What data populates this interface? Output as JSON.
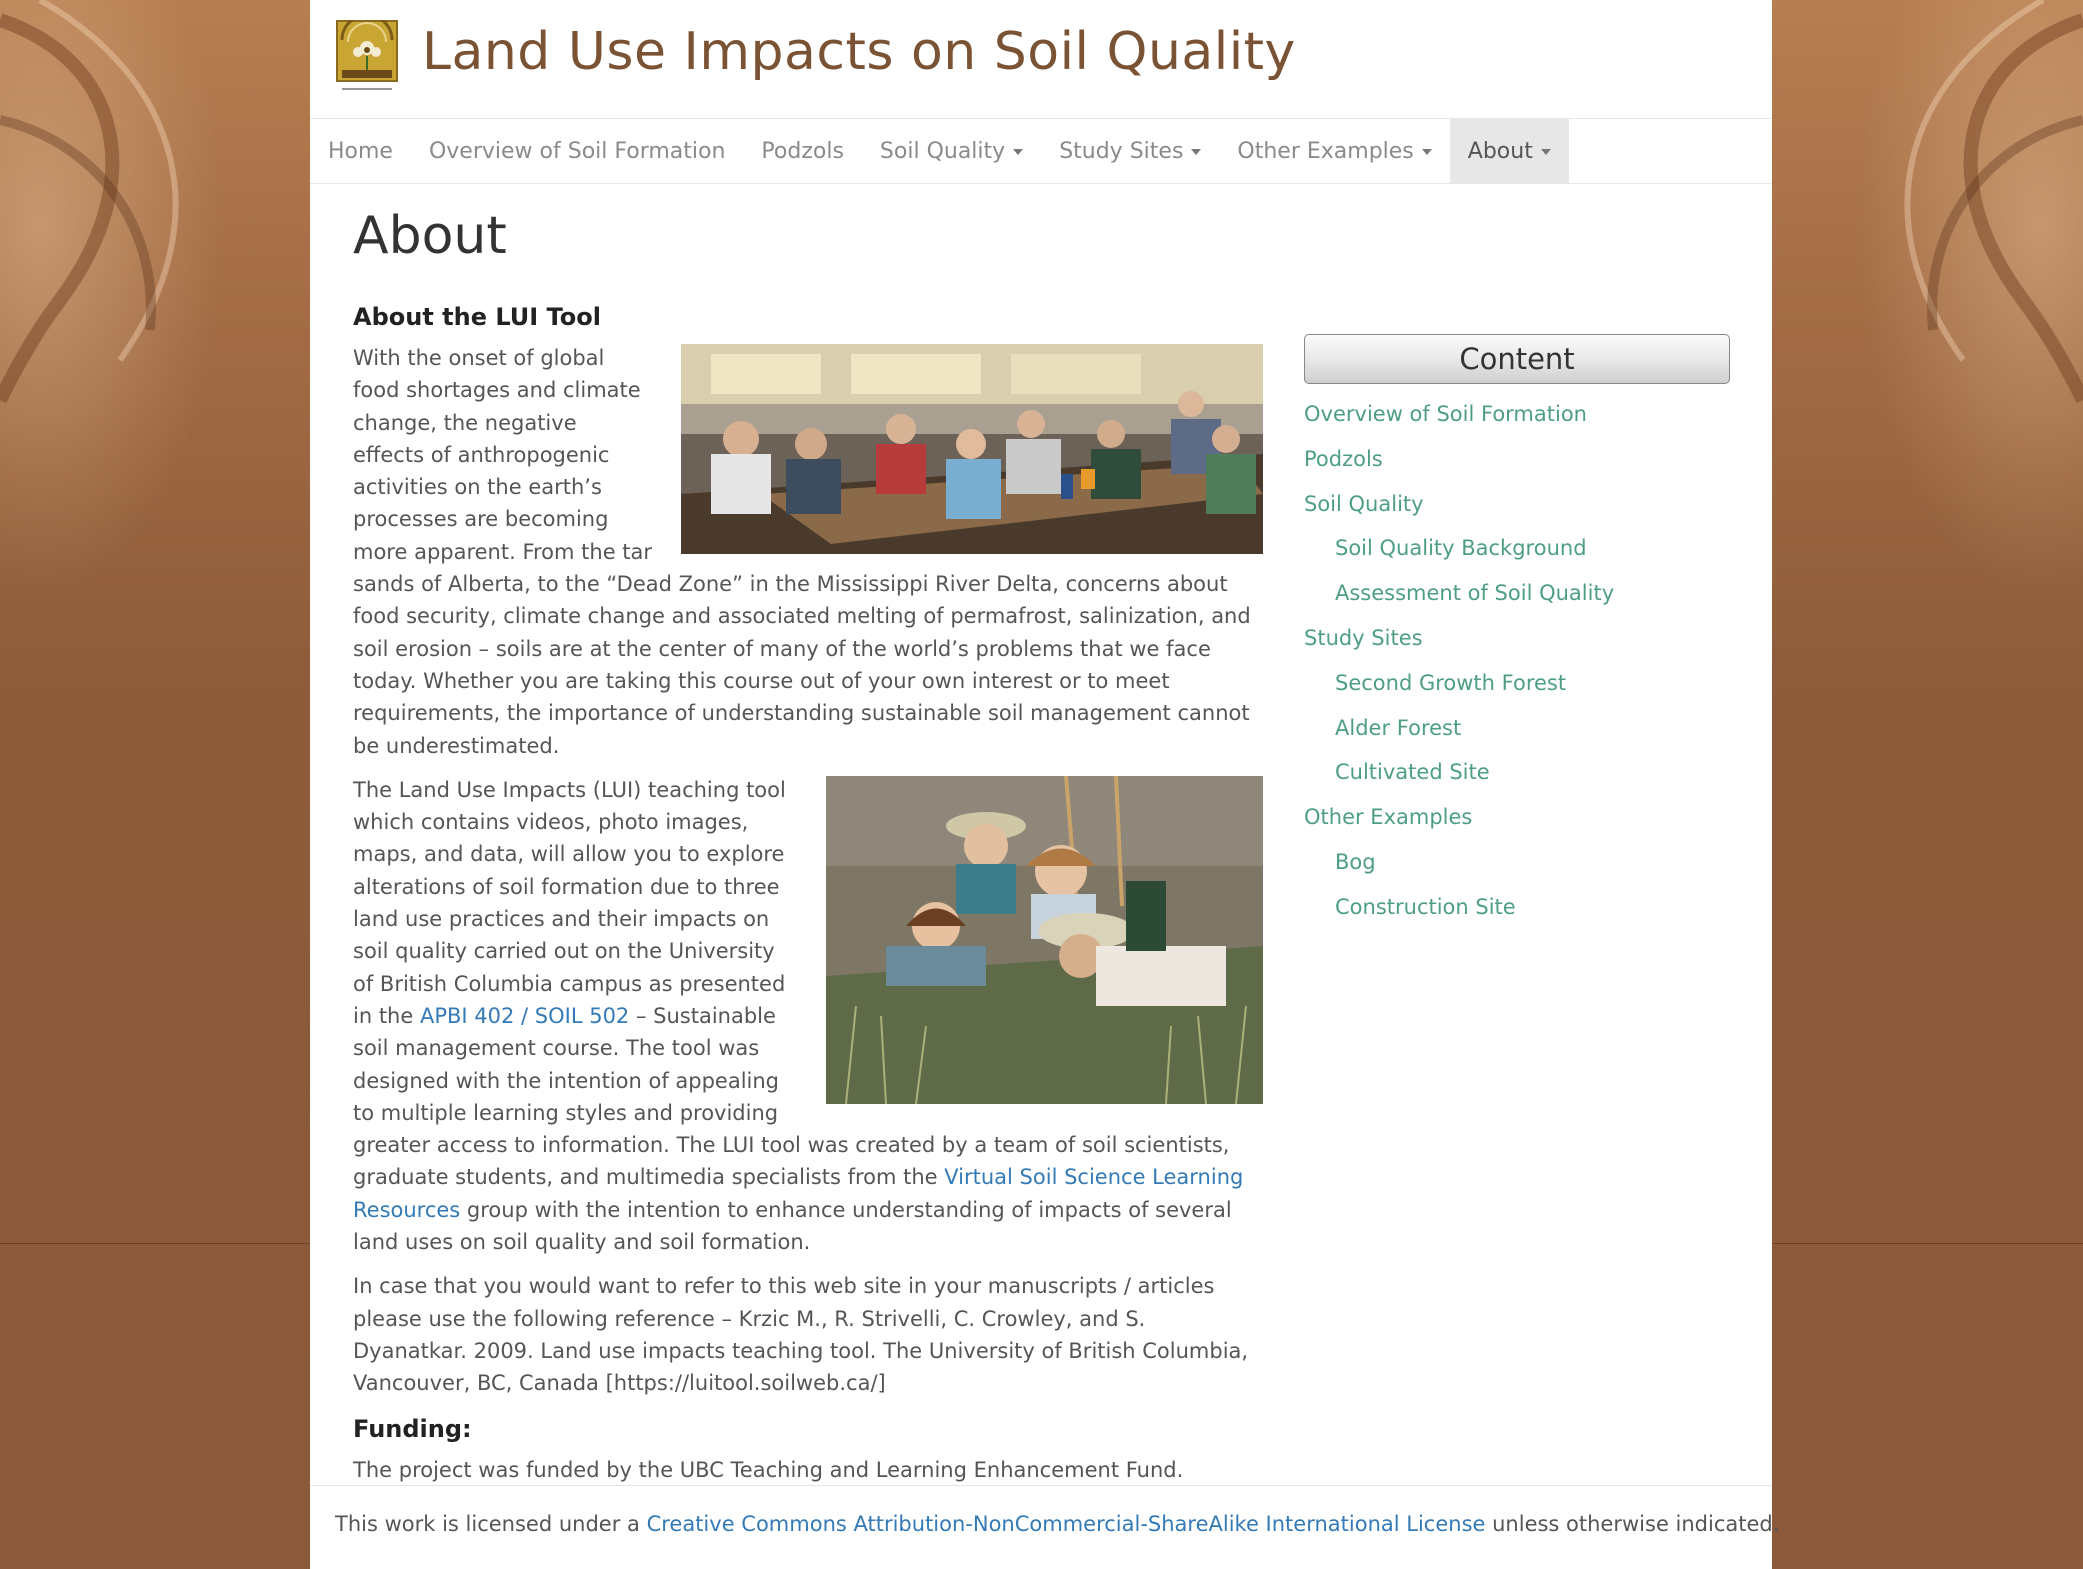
{
  "site": {
    "title": "Land Use Impacts on Soil Quality",
    "logo_icon": "luitool-logo-icon"
  },
  "nav": {
    "items": [
      {
        "label": "Home",
        "dropdown": false,
        "active": false
      },
      {
        "label": "Overview of Soil Formation",
        "dropdown": false,
        "active": false
      },
      {
        "label": "Podzols",
        "dropdown": false,
        "active": false
      },
      {
        "label": "Soil Quality",
        "dropdown": true,
        "active": false
      },
      {
        "label": "Study Sites",
        "dropdown": true,
        "active": false
      },
      {
        "label": "Other Examples",
        "dropdown": true,
        "active": false
      },
      {
        "label": "About",
        "dropdown": true,
        "active": true
      }
    ]
  },
  "page": {
    "title": "About"
  },
  "main": {
    "about_heading": "About the LUI Tool",
    "para1": "With the onset of global food shortages and climate change, the negative effects of anthropogenic activities on the earth’s processes are becoming more apparent. From the tar sands of Alberta, to the “Dead Zone” in the Mississippi River Delta, concerns about food security, climate change and associated melting of permafrost, salinization, and soil erosion – soils are at the center of many of the world’s problems that we face today. Whether you are taking this course out of your own interest or to meet requirements, the importance of understanding sustainable soil management cannot be underestimated.",
    "para2_part1": "The Land Use Impacts (LUI) teaching tool which contains videos, photo images, maps, and data, will allow you to explore alterations of soil formation due to three land use practices and their impacts on soil quality carried out on the University of British Columbia campus as presented in the ",
    "para2_link1": "APBI 402 / SOIL 502",
    "para2_part2": " – Sustainable soil management course. The tool was designed with the intention of appealing to multiple learning styles and providing greater access to information. The LUI tool was created by a team of soil scientists, graduate students, and multimedia specialists from the ",
    "para2_link2": "Virtual Soil Science Learning Resources",
    "para2_part3": " group with the intention to enhance understanding of impacts of several land uses on soil quality and soil formation.",
    "para3": "In case that you would want to refer to this web site in your manuscripts / articles please use the following reference – Krzic M., R. Strivelli, C. Crowley, and S. Dyanatkar. 2009. Land use impacts teaching tool. The University of British Columbia, Vancouver, BC, Canada [https://luitool.soilweb.ca/]",
    "funding_heading": "Funding:",
    "funding_text": "The project was funded by the UBC Teaching and Learning Enhancement Fund."
  },
  "sidebar": {
    "heading": "Content",
    "items": [
      {
        "label": "Overview of Soil Formation",
        "sub": false
      },
      {
        "label": "Podzols",
        "sub": false
      },
      {
        "label": "Soil Quality",
        "sub": false
      },
      {
        "label": "Soil Quality Background",
        "sub": true
      },
      {
        "label": "Assessment of Soil Quality",
        "sub": true
      },
      {
        "label": "Study Sites",
        "sub": false
      },
      {
        "label": "Second Growth Forest",
        "sub": true
      },
      {
        "label": "Alder Forest",
        "sub": true
      },
      {
        "label": "Cultivated Site",
        "sub": true
      },
      {
        "label": "Other Examples",
        "sub": false
      },
      {
        "label": "Bog",
        "sub": true
      },
      {
        "label": "Construction Site",
        "sub": true
      }
    ]
  },
  "footer": {
    "text_before": "This work is licensed under a ",
    "link": "Creative Commons Attribution-NonCommercial-ShareAlike International License",
    "text_after": " unless otherwise indicated."
  },
  "colors": {
    "title_brown": "#7a5234",
    "link_blue": "#337ab7",
    "sidebar_link_green": "#4e9e87",
    "background_brown": "#8b5a3a"
  }
}
